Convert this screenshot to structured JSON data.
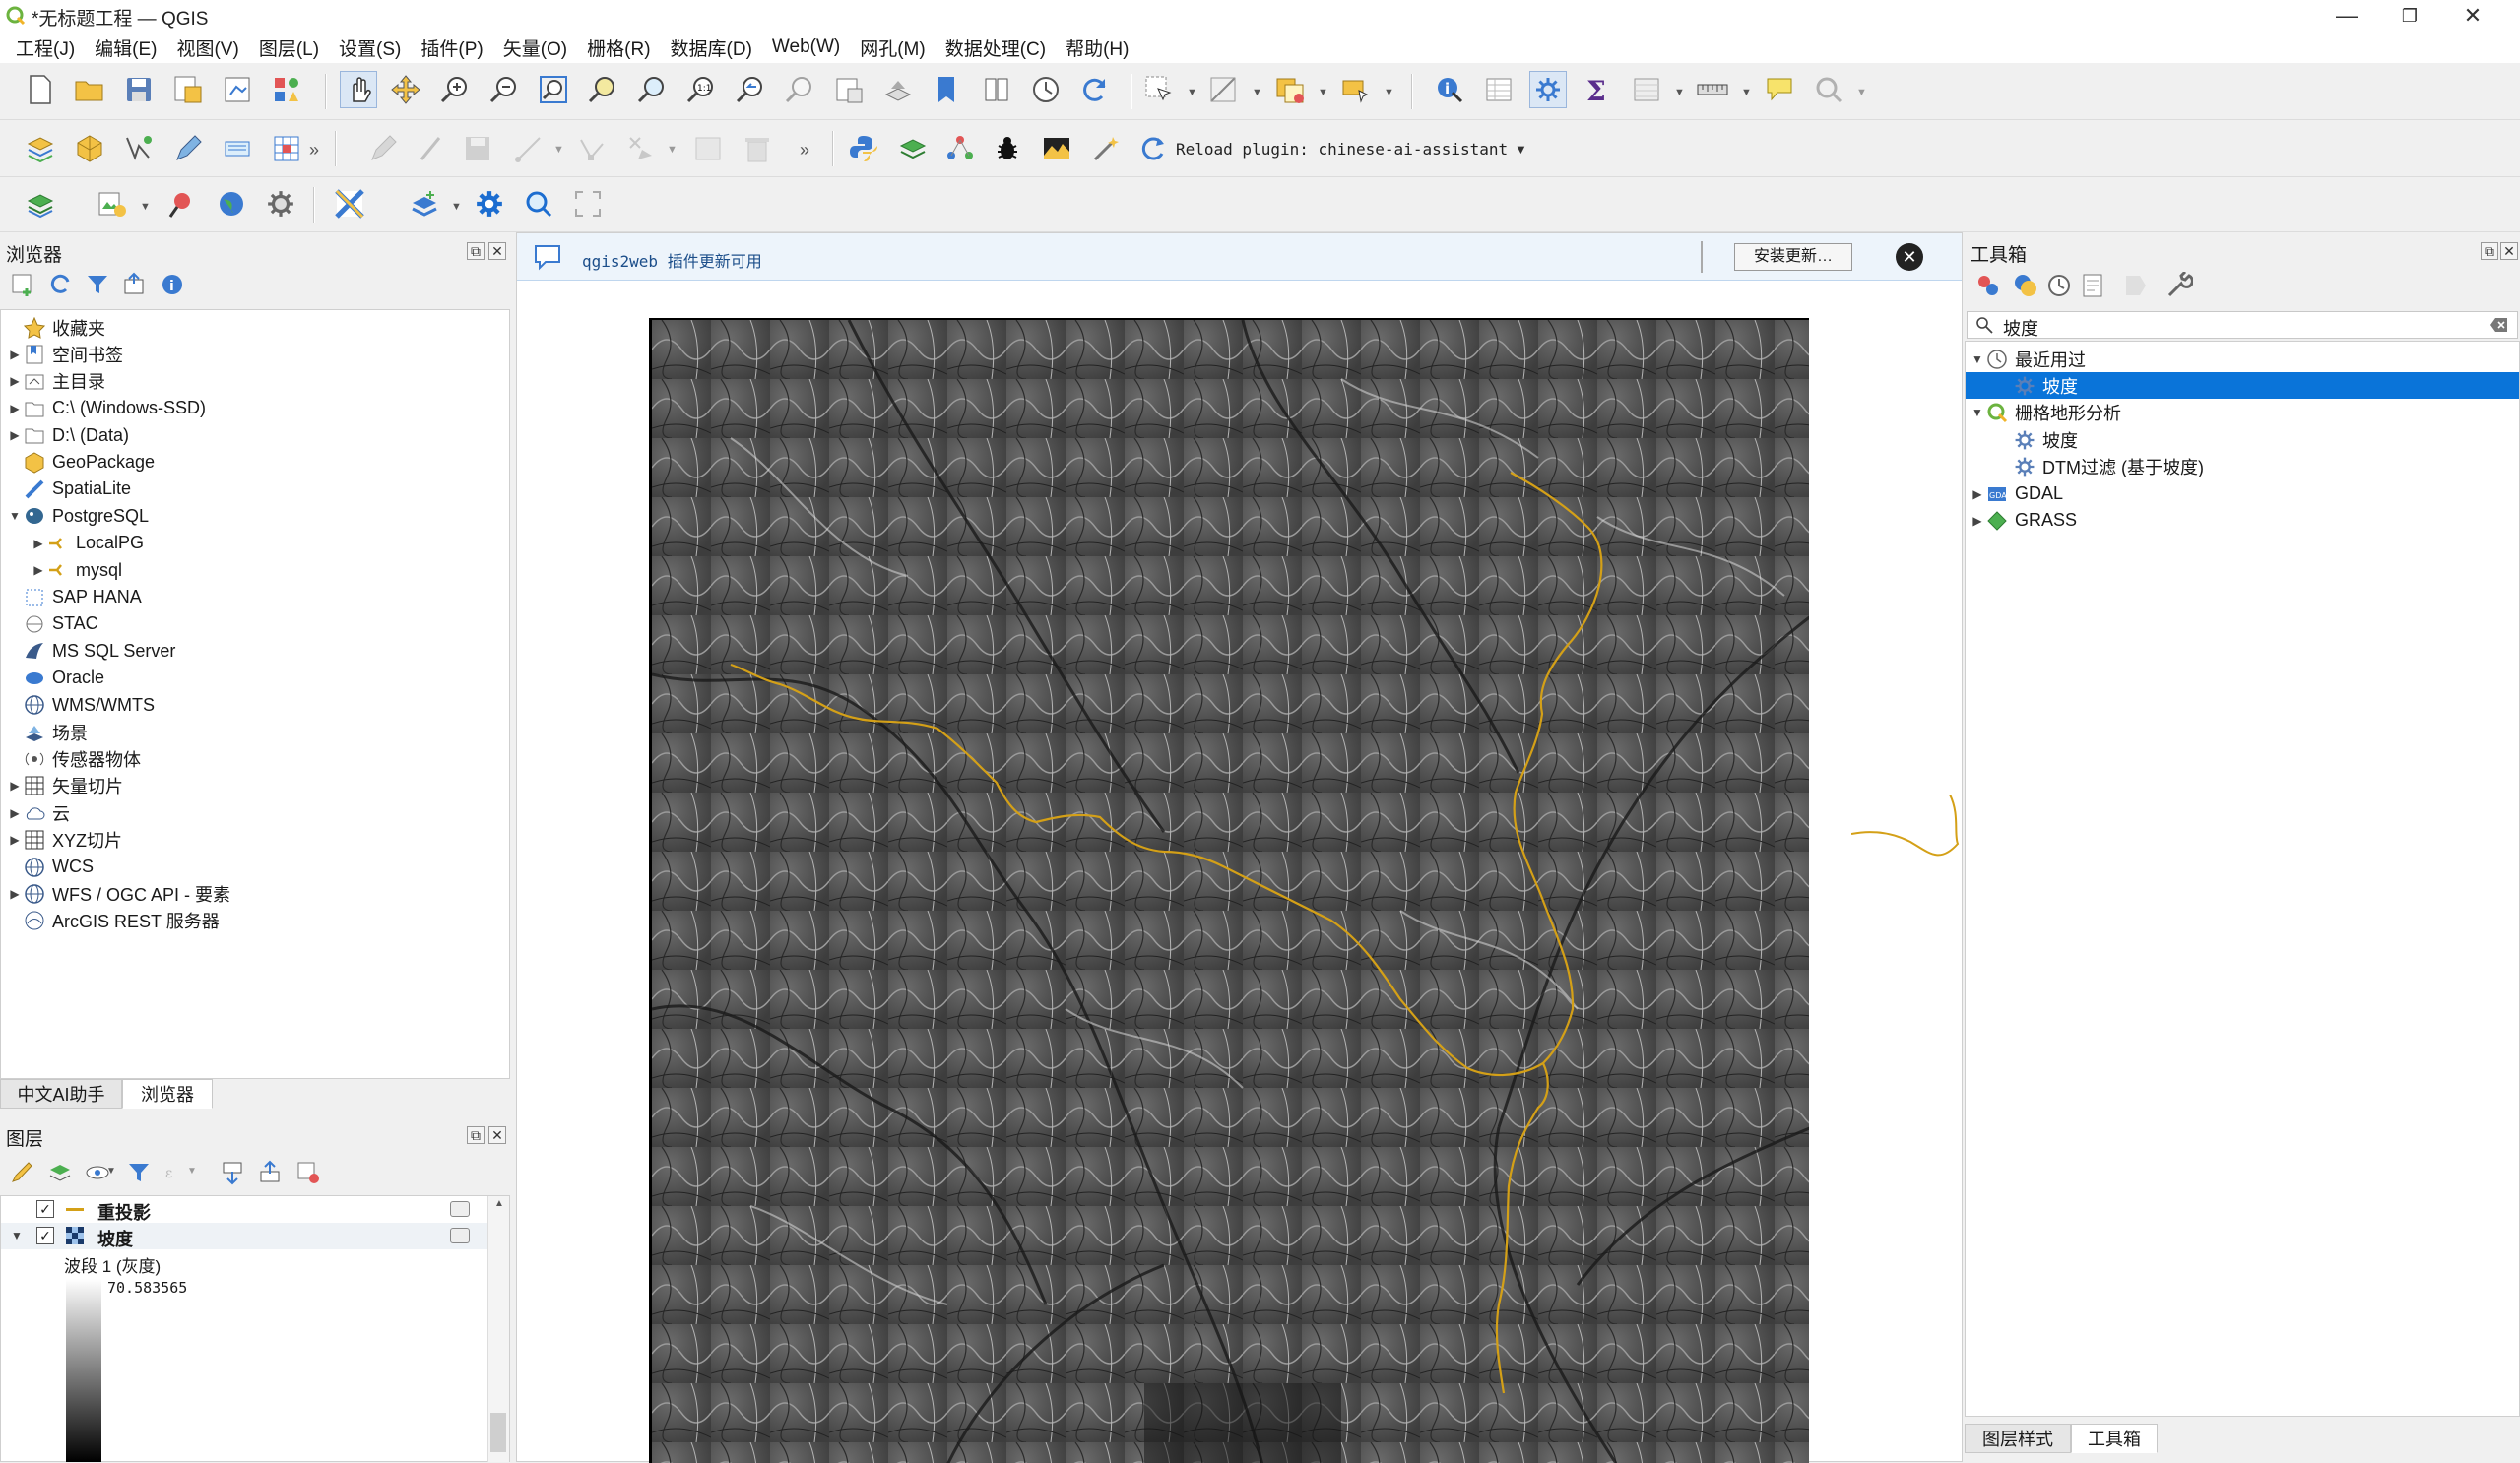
{
  "window": {
    "title": "*无标题工程 — QGIS",
    "min": "—",
    "max": "❐",
    "close": "✕"
  },
  "menu": [
    "工程(J)",
    "编辑(E)",
    "视图(V)",
    "图层(L)",
    "设置(S)",
    "插件(P)",
    "矢量(O)",
    "栅格(R)",
    "数据库(D)",
    "Web(W)",
    "网孔(M)",
    "数据处理(C)",
    "帮助(H)"
  ],
  "plugin_toolbar": {
    "reload_label": "Reload plugin: chinese-ai-assistant"
  },
  "browser": {
    "title": "浏览器",
    "items": [
      {
        "label": "收藏夹",
        "icon": "star-icon",
        "expand": false
      },
      {
        "label": "空间书签",
        "icon": "bookmark-icon",
        "expand": true
      },
      {
        "label": "主目录",
        "icon": "home-folder-icon",
        "expand": true
      },
      {
        "label": "C:\\ (Windows-SSD)",
        "icon": "drive-icon",
        "expand": true
      },
      {
        "label": "D:\\ (Data)",
        "icon": "drive-icon",
        "expand": true
      },
      {
        "label": "GeoPackage",
        "icon": "geopackage-icon",
        "expand": false
      },
      {
        "label": "SpatiaLite",
        "icon": "spatialite-icon",
        "expand": false
      },
      {
        "label": "PostgreSQL",
        "icon": "postgresql-icon",
        "expand": "open"
      },
      {
        "label": "LocalPG",
        "icon": "connection-icon",
        "expand": true,
        "indent": 1
      },
      {
        "label": "mysql",
        "icon": "connection-icon",
        "expand": true,
        "indent": 1
      },
      {
        "label": "SAP HANA",
        "icon": "saphana-icon",
        "expand": false
      },
      {
        "label": "STAC",
        "icon": "stac-icon",
        "expand": false
      },
      {
        "label": "MS SQL Server",
        "icon": "mssql-icon",
        "expand": false
      },
      {
        "label": "Oracle",
        "icon": "oracle-icon",
        "expand": false
      },
      {
        "label": "WMS/WMTS",
        "icon": "globe-icon",
        "expand": false
      },
      {
        "label": "场景",
        "icon": "scene-icon",
        "expand": false
      },
      {
        "label": "传感器物体",
        "icon": "sensor-icon",
        "expand": false
      },
      {
        "label": "矢量切片",
        "icon": "grid-icon",
        "expand": true
      },
      {
        "label": "云",
        "icon": "cloud-icon",
        "expand": true
      },
      {
        "label": "XYZ切片",
        "icon": "grid-icon",
        "expand": true
      },
      {
        "label": "WCS",
        "icon": "globe-icon",
        "expand": false
      },
      {
        "label": "WFS / OGC API - 要素",
        "icon": "globe-icon",
        "expand": true
      },
      {
        "label": "ArcGIS REST 服务器",
        "icon": "arcgis-icon",
        "expand": false
      }
    ],
    "tabs": [
      "中文AI助手",
      "浏览器"
    ]
  },
  "layers": {
    "title": "图层",
    "items": [
      {
        "label": "重投影",
        "checked": true
      },
      {
        "label": "坡度",
        "checked": true
      }
    ],
    "legend_band": "波段 1 (灰度)",
    "legend_max": "70.583565"
  },
  "message_bar": {
    "text": "qgis2web 插件更新可用",
    "button": "安装更新…"
  },
  "toolbox": {
    "title": "工具箱",
    "search_value": "坡度",
    "tree": [
      {
        "label": "最近用过",
        "icon": "clock-icon",
        "expand": "open",
        "indent": 0
      },
      {
        "label": "坡度",
        "icon": "gear-icon",
        "indent": 1,
        "selected": true
      },
      {
        "label": "栅格地形分析",
        "icon": "qgis-icon",
        "expand": "open",
        "indent": 0
      },
      {
        "label": "坡度",
        "icon": "gear-icon",
        "indent": 1
      },
      {
        "label": "DTM过滤 (基于坡度)",
        "icon": "gear-icon",
        "indent": 1
      },
      {
        "label": "GDAL",
        "icon": "gdal-icon",
        "expand": true,
        "indent": 0
      },
      {
        "label": "GRASS",
        "icon": "grass-icon",
        "expand": true,
        "indent": 0
      }
    ],
    "tabs": [
      "图层样式",
      "工具箱"
    ]
  },
  "colors": {
    "selection": "#0a74d9",
    "accent": "#1c6dd0",
    "boundary": "#d4a017"
  }
}
